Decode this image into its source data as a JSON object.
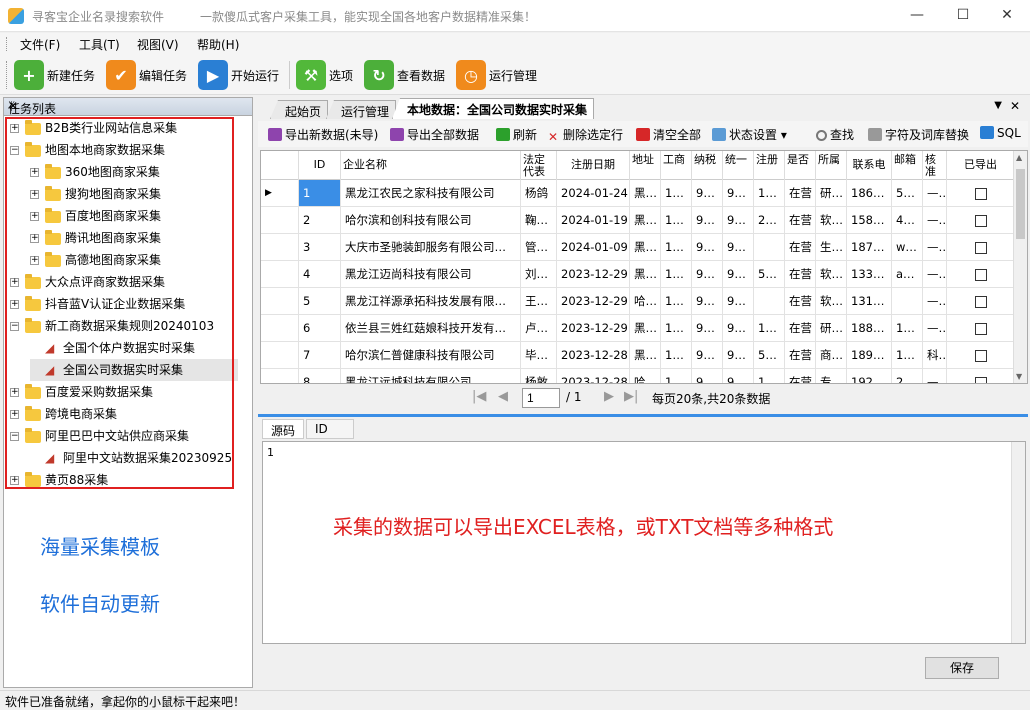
{
  "window": {
    "title": "寻客宝企业名录搜索软件",
    "slogan": "一款傻瓜式客户采集工具，能实现全国各地客户数据精准采集！",
    "controls": {
      "minimize": "—",
      "maximize": "☐",
      "close": "✕"
    }
  },
  "menu": [
    "文件(F)",
    "工具(T)",
    "视图(V)",
    "帮助(H)"
  ],
  "toolbar": [
    {
      "label": "新建任务",
      "icon": "plus-icon",
      "color": "#4caf3a",
      "glyph": "+"
    },
    {
      "label": "编辑任务",
      "icon": "check-icon",
      "color": "#f08a1c",
      "glyph": "✔"
    },
    {
      "label": "开始运行",
      "icon": "play-icon",
      "color": "#2a7fd4",
      "glyph": "▶"
    },
    {
      "label": "选项",
      "icon": "wrench-icon",
      "color": "#52b83a",
      "glyph": "⚒"
    },
    {
      "label": "查看数据",
      "icon": "refresh-icon",
      "color": "#4caf3a",
      "glyph": "↻"
    },
    {
      "label": "运行管理",
      "icon": "clock-icon",
      "color": "#f08a1c",
      "glyph": "◷"
    }
  ],
  "task_panel": {
    "title": "任务列表",
    "pin": "ᛘ",
    "close": "✕",
    "tree": [
      {
        "label": "B2B类行业网站信息采集",
        "level": 0,
        "kind": "folder",
        "exp": "+"
      },
      {
        "label": "地图本地商家数据采集",
        "level": 0,
        "kind": "folder",
        "exp": "−"
      },
      {
        "label": "360地图商家采集",
        "level": 1,
        "kind": "folder",
        "exp": "+"
      },
      {
        "label": "搜狗地图商家采集",
        "level": 1,
        "kind": "folder",
        "exp": "+"
      },
      {
        "label": "百度地图商家采集",
        "level": 1,
        "kind": "folder",
        "exp": "+"
      },
      {
        "label": "腾讯地图商家采集",
        "level": 1,
        "kind": "folder",
        "exp": "+"
      },
      {
        "label": "高德地图商家采集",
        "level": 1,
        "kind": "folder",
        "exp": "+"
      },
      {
        "label": "大众点评商家数据采集",
        "level": 0,
        "kind": "folder",
        "exp": "+"
      },
      {
        "label": "抖音蓝V认证企业数据采集",
        "level": 0,
        "kind": "folder",
        "exp": "+"
      },
      {
        "label": "新工商数据采集规则20240103",
        "level": 0,
        "kind": "folder",
        "exp": "−"
      },
      {
        "label": "全国个体户数据实时采集",
        "level": 1,
        "kind": "task",
        "exp": ""
      },
      {
        "label": "全国公司数据实时采集",
        "level": 1,
        "kind": "task",
        "exp": "",
        "selected": true
      },
      {
        "label": "百度爱采购数据采集",
        "level": 0,
        "kind": "folder",
        "exp": "+"
      },
      {
        "label": "跨境电商采集",
        "level": 0,
        "kind": "folder",
        "exp": "+"
      },
      {
        "label": "阿里巴巴中文站供应商采集",
        "level": 0,
        "kind": "folder",
        "exp": "−"
      },
      {
        "label": "阿里中文站数据采集20230925",
        "level": 1,
        "kind": "task",
        "exp": ""
      },
      {
        "label": "黄页88采集",
        "level": 0,
        "kind": "folder",
        "exp": "+"
      }
    ],
    "promo1": "海量采集模板",
    "promo2": "软件自动更新"
  },
  "doc_tabs": [
    "起始页",
    "运行管理",
    "本地数据：全国公司数据实时采集"
  ],
  "data_toolbar": [
    {
      "label": "导出新数据(未导)",
      "icon": "export-new-icon",
      "color": "#8e44ad"
    },
    {
      "label": "导出全部数据",
      "icon": "export-all-icon",
      "color": "#8e44ad"
    },
    {
      "label": "刷新",
      "icon": "refresh-icon",
      "color": "#2ca02c"
    },
    {
      "label": "删除选定行",
      "icon": "delete-icon",
      "color": "#d62728"
    },
    {
      "label": "清空全部",
      "icon": "clear-icon",
      "color": "#d62728"
    },
    {
      "label": "状态设置 ▾",
      "icon": "status-icon",
      "color": "#5b9bd5"
    },
    {
      "label": "查找",
      "icon": "search-icon",
      "color": "#777777"
    },
    {
      "label": "字符及词库替换",
      "icon": "replace-icon",
      "color": "#777777"
    },
    {
      "label": "SQL",
      "icon": "sql-icon",
      "color": "#2a7fd4"
    }
  ],
  "grid": {
    "headers": [
      "ID",
      "企业名称",
      "法定代表",
      "注册日期",
      "地址",
      "工商",
      "纳税",
      "统一",
      "注册",
      "是否",
      "所属",
      "联系电话",
      "邮箱",
      "核准",
      "已导出"
    ],
    "rows": [
      [
        "1",
        "黑龙江农民之家科技有限公司",
        "杨鸽",
        "2024-01-24",
        "黑…",
        "1…",
        "9…",
        "9…",
        "1…",
        "在营",
        "研…",
        "186…",
        "5…",
        "—…",
        ""
      ],
      [
        "2",
        "哈尔滨和创科技有限公司",
        "鞠…",
        "2024-01-19",
        "黑…",
        "1…",
        "9…",
        "9…",
        "2…",
        "在营",
        "软…",
        "158…",
        "4…",
        "—…",
        ""
      ],
      [
        "3",
        "大庆市圣驰装卸服务有限公司…",
        "管…",
        "2024-01-09",
        "黑…",
        "1…",
        "9…",
        "9…",
        "",
        "在营",
        "生…",
        "187…",
        "w…",
        "—…",
        ""
      ],
      [
        "4",
        "黑龙江迈尚科技有限公司",
        "刘…",
        "2023-12-29",
        "黑…",
        "1…",
        "9…",
        "9…",
        "5…",
        "在营",
        "软…",
        "133…",
        "a…",
        "—…",
        ""
      ],
      [
        "5",
        "黑龙江祥源承拓科技发展有限…",
        "王…",
        "2023-12-29",
        "哈…",
        "1…",
        "9…",
        "9…",
        "",
        "在营",
        "软…",
        "131…",
        "",
        "—…",
        ""
      ],
      [
        "6",
        "依兰县三姓红菇娘科技开发有…",
        "卢…",
        "2023-12-29",
        "黑…",
        "1…",
        "9…",
        "9…",
        "1…",
        "在营",
        "研…",
        "188…",
        "1…",
        "—…",
        ""
      ],
      [
        "7",
        "哈尔滨仁普健康科技有限公司",
        "毕…",
        "2023-12-28",
        "黑…",
        "1…",
        "9…",
        "9…",
        "5…",
        "在营",
        "商…",
        "189…",
        "1…",
        "科…",
        ""
      ],
      [
        "8",
        "黑龙江远城科技有限公司",
        "杨敦",
        "2023-12-28",
        "哈…",
        "1…",
        "9…",
        "9…",
        "1…",
        "在营",
        "专…",
        "192…",
        "2…",
        "—…",
        ""
      ]
    ]
  },
  "pager": {
    "page": "1",
    "total": "/ 1",
    "summary": "每页20条,共20条数据"
  },
  "bottom_tabs": [
    "源码",
    "ID"
  ],
  "source_text": "1",
  "overlay_text": "采集的数据可以导出EXCEL表格，或TXT文档等多种格式",
  "save_label": "保存",
  "status_text": "软件已准备就绪，拿起你的小鼠标干起来吧！",
  "colors": {
    "selection": "#3a8ee6",
    "annotation_red": "#e02020",
    "promo_blue": "#1e6fd9"
  }
}
